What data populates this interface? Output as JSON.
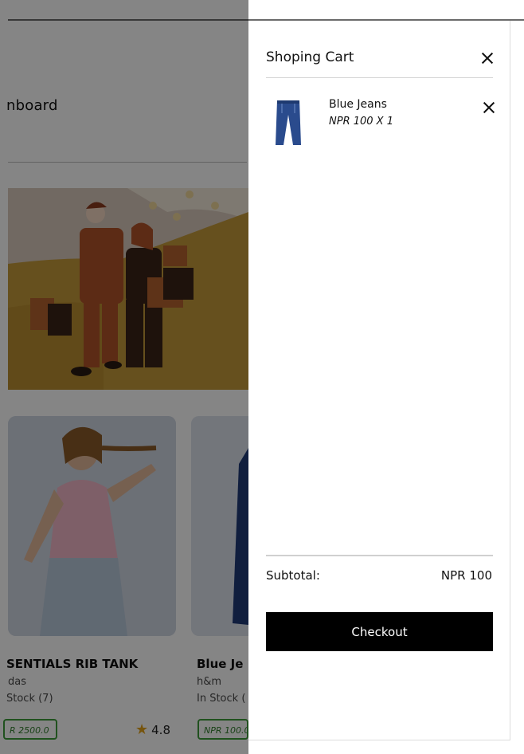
{
  "page": {
    "dashboard_title": "nboard",
    "products": [
      {
        "name": "SENTIALS RIB TANK",
        "brand": "das",
        "stock": "Stock (7)",
        "price": "R 2500.0",
        "rating": "4.8"
      },
      {
        "name": "Blue Je",
        "brand": "h&m",
        "stock": "In Stock (",
        "price": "NPR 100.0"
      }
    ]
  },
  "cart": {
    "title": "Shoping Cart",
    "items": [
      {
        "name": "Blue Jeans",
        "price_qty": "NPR 100 X 1"
      }
    ],
    "subtotal_label": "Subtotal:",
    "subtotal_value": "NPR 100",
    "checkout_label": "Checkout"
  },
  "colors": {
    "overlay": "#000000",
    "checkout_bg": "#000000",
    "price_border": "#3e9b3a",
    "star": "#e3a21a"
  }
}
